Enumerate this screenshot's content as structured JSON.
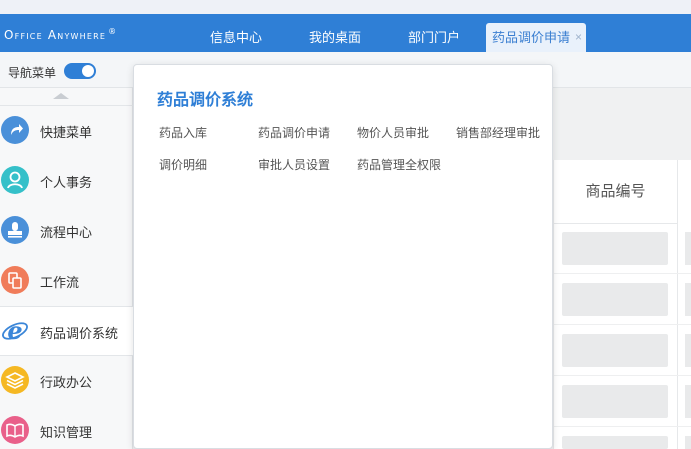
{
  "header": {
    "brand": "Office Anywhere",
    "registered_mark": "®",
    "tabs": [
      {
        "label": "信息中心"
      },
      {
        "label": "我的桌面"
      },
      {
        "label": "部门门户"
      },
      {
        "label": "药品调价申请",
        "active": true
      }
    ],
    "tab_close": "×",
    "accent_color": "#2f7fd6"
  },
  "toolbar": {
    "nav_menu_label": "导航菜单",
    "nav_toggle_on": true
  },
  "sidebar": {
    "items": [
      {
        "label": "快捷菜单",
        "icon": "share-arrow-icon",
        "color": "#4a90d9"
      },
      {
        "label": "个人事务",
        "icon": "user-icon",
        "color": "#35c0c9"
      },
      {
        "label": "流程中心",
        "icon": "stamp-icon",
        "color": "#4a90d9"
      },
      {
        "label": "工作流",
        "icon": "workflow-icon",
        "color": "#f07c5a"
      },
      {
        "label": "药品调价系统",
        "icon": "ie-browser-icon",
        "color": "#3b86d8",
        "active": true
      },
      {
        "label": "行政办公",
        "icon": "layers-icon",
        "color": "#f5b823"
      },
      {
        "label": "知识管理",
        "icon": "book-icon",
        "color": "#e9608a"
      }
    ]
  },
  "table": {
    "header": "商品编号"
  },
  "dropdown": {
    "title": "药品调价系统",
    "links": [
      "药品入库",
      "药品调价申请",
      "物价人员审批",
      "销售部经理审批",
      "调价明细",
      "审批人员设置",
      "药品管理全权限"
    ]
  }
}
